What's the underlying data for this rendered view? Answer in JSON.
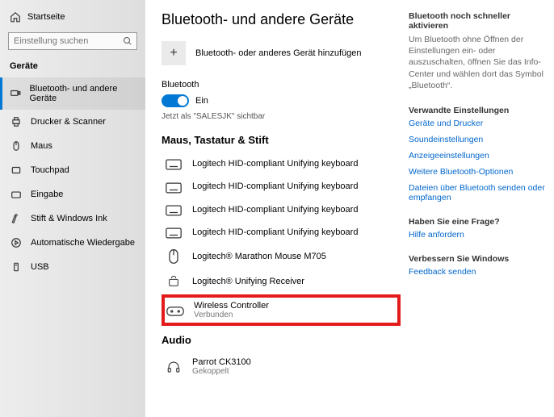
{
  "sidebar": {
    "home": "Startseite",
    "search_placeholder": "Einstellung suchen",
    "section": "Geräte",
    "items": [
      {
        "label": "Bluetooth- und andere Geräte",
        "active": true
      },
      {
        "label": "Drucker & Scanner"
      },
      {
        "label": "Maus"
      },
      {
        "label": "Touchpad"
      },
      {
        "label": "Eingabe"
      },
      {
        "label": "Stift & Windows Ink"
      },
      {
        "label": "Automatische Wiedergabe"
      },
      {
        "label": "USB"
      }
    ]
  },
  "main": {
    "title": "Bluetooth- und andere Geräte",
    "add_label": "Bluetooth- oder anderes Gerät hinzufügen",
    "bt_heading": "Bluetooth",
    "bt_state": "Ein",
    "discoverable": "Jetzt als \"SALESJK\" sichtbar",
    "group1": "Maus, Tastatur & Stift",
    "devices1": [
      {
        "name": "Logitech HID-compliant Unifying keyboard",
        "icon": "keyboard"
      },
      {
        "name": "Logitech HID-compliant Unifying keyboard",
        "icon": "keyboard"
      },
      {
        "name": "Logitech HID-compliant Unifying keyboard",
        "icon": "keyboard"
      },
      {
        "name": "Logitech HID-compliant Unifying keyboard",
        "icon": "keyboard"
      },
      {
        "name": "Logitech® Marathon Mouse M705",
        "icon": "mouse"
      },
      {
        "name": "Logitech® Unifying Receiver",
        "icon": "receiver"
      },
      {
        "name": "Wireless Controller",
        "status": "Verbunden",
        "icon": "gamepad",
        "highlight": true
      }
    ],
    "group2": "Audio",
    "devices2": [
      {
        "name": "Parrot CK3100",
        "status": "Gekoppelt",
        "icon": "headset"
      }
    ]
  },
  "right": {
    "fast_title": "Bluetooth noch schneller aktivieren",
    "fast_body": "Um Bluetooth ohne Öffnen der Einstellungen ein- oder auszuschalten, öffnen Sie das Info-Center und wählen dort das Symbol „Bluetooth“.",
    "related_title": "Verwandte Einstellungen",
    "related_links": [
      "Geräte und Drucker",
      "Soundeinstellungen",
      "Anzeigeeinstellungen",
      "Weitere Bluetooth-Optionen",
      "Dateien über Bluetooth senden oder empfangen"
    ],
    "help_title": "Haben Sie eine Frage?",
    "help_link": "Hilfe anfordern",
    "improve_title": "Verbessern Sie Windows",
    "improve_link": "Feedback senden"
  }
}
